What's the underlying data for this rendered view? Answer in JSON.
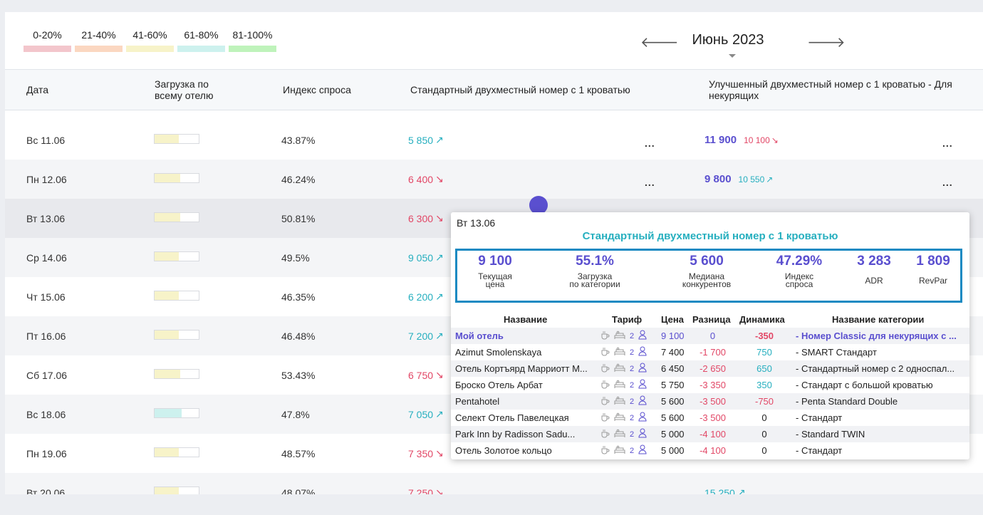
{
  "legend": [
    {
      "label": "0-20%",
      "color": "#f3c6cc"
    },
    {
      "label": "21-40%",
      "color": "#fbd7c1"
    },
    {
      "label": "41-60%",
      "color": "#f7f3c9"
    },
    {
      "label": "61-80%",
      "color": "#cdf1ee"
    },
    {
      "label": "81-100%",
      "color": "#bff3bb"
    }
  ],
  "nav": {
    "month": "Июнь 2023",
    "prev": "🡐",
    "next": "🡒"
  },
  "headers": {
    "date": "Дата",
    "load": "Загрузка по всему отелю",
    "demand": "Индекс спроса",
    "room1": "Стандартный двухместный номер с 1 кроватью",
    "room2": "Улучшенный двухместный номер с 1 кроватью - Для некурящих"
  },
  "rows": [
    {
      "date": "Вс 11.06",
      "load_pct": 55,
      "load_color": "#f7f3c9",
      "demand": "43.87%",
      "p1": "5 850",
      "p1_trend": "up",
      "p2": "11 900",
      "p2_sub": "10 100",
      "p2_trend": "down"
    },
    {
      "date": "Пн 12.06",
      "load_pct": 58,
      "load_color": "#f7f3c9",
      "demand": "46.24%",
      "p1": "6 400",
      "p1_trend": "down",
      "p2": "9 800",
      "p2_sub": "10 550",
      "p2_trend": "up"
    },
    {
      "date": "Вт 13.06",
      "load_pct": 58,
      "load_color": "#f7f3c9",
      "demand": "50.81%",
      "p1": "6 300",
      "p1_trend": "down",
      "p2": "",
      "p2_sub": "",
      "p2_trend": ""
    },
    {
      "date": "Ср 14.06",
      "load_pct": 55,
      "load_color": "#f7f3c9",
      "demand": "49.5%",
      "p1": "9 050",
      "p1_trend": "up",
      "p2": "",
      "p2_sub": "",
      "p2_trend": ""
    },
    {
      "date": "Чт 15.06",
      "load_pct": 55,
      "load_color": "#f7f3c9",
      "demand": "46.35%",
      "p1": "6 200",
      "p1_trend": "up",
      "p2": "",
      "p2_sub": "",
      "p2_trend": ""
    },
    {
      "date": "Пт 16.06",
      "load_pct": 55,
      "load_color": "#f7f3c9",
      "demand": "46.48%",
      "p1": "7 200",
      "p1_trend": "up",
      "p2": "",
      "p2_sub": "",
      "p2_trend": ""
    },
    {
      "date": "Сб 17.06",
      "load_pct": 58,
      "load_color": "#f7f3c9",
      "demand": "53.43%",
      "p1": "6 750",
      "p1_trend": "down",
      "p2": "",
      "p2_sub": "",
      "p2_trend": ""
    },
    {
      "date": "Вс 18.06",
      "load_pct": 62,
      "load_color": "#cdf1ee",
      "demand": "47.8%",
      "p1": "7 050",
      "p1_trend": "up",
      "p2": "",
      "p2_sub": "",
      "p2_trend": ""
    },
    {
      "date": "Пн 19.06",
      "load_pct": 55,
      "load_color": "#f7f3c9",
      "demand": "48.57%",
      "p1": "7 350",
      "p1_trend": "down",
      "p2": "",
      "p2_sub": "",
      "p2_trend": ""
    },
    {
      "date": "Вт 20.06",
      "load_pct": 55,
      "load_color": "#f7f3c9",
      "demand": "48.07%",
      "p1": "7 250",
      "p1_trend": "down",
      "p2": "15 250",
      "p2_sub": "",
      "p2_trend": "up"
    }
  ],
  "trend_glyphs": {
    "up": "↗",
    "down": "↘"
  },
  "dots": "...",
  "popup": {
    "date": "Вт 13.06",
    "title": "Стандартный двухместный номер с 1 кроватью",
    "kpis": [
      {
        "value": "9 100",
        "label1": "Текущая",
        "label2": "цена"
      },
      {
        "value": "55.1%",
        "label1": "Загрузка",
        "label2": "по категории"
      },
      {
        "value": "5 600",
        "label1": "Медиана",
        "label2": "конкурентов"
      },
      {
        "value": "47.29%",
        "label1": "Индекс",
        "label2": "спроса"
      },
      {
        "value": "3 283",
        "label1": "ADR",
        "label2": ""
      },
      {
        "value": "1 809",
        "label1": "RevPar",
        "label2": ""
      }
    ],
    "columns": {
      "name": "Название",
      "tariff": "Тариф",
      "price": "Цена",
      "diff": "Разница",
      "dynamics": "Динамика",
      "category": "Название категории"
    },
    "rows": [
      {
        "name": "Мой отель",
        "guests": "2",
        "price": "9 100",
        "diff": "0",
        "dyn": "-350",
        "category": "- Номер Classic для некурящих с ...",
        "own": true
      },
      {
        "name": "Azimut Smolenskaya",
        "guests": "2",
        "price": "7 400",
        "diff": "-1 700",
        "dyn": "750",
        "category": "- SMART Стандарт",
        "own": false
      },
      {
        "name": "Отель Кортъярд Марриотт М...",
        "guests": "2",
        "price": "6 450",
        "diff": "-2 650",
        "dyn": "650",
        "category": "- Стандартный номер с 2 односпал...",
        "own": false
      },
      {
        "name": "Броско Отель Арбат",
        "guests": "2",
        "price": "5 750",
        "diff": "-3 350",
        "dyn": "350",
        "category": "- Стандарт с большой кроватью",
        "own": false
      },
      {
        "name": "Pentahotel",
        "guests": "2",
        "price": "5 600",
        "diff": "-3 500",
        "dyn": "-750",
        "category": "- Penta Standard Double",
        "own": false
      },
      {
        "name": "Селект Отель Павелецкая",
        "guests": "2",
        "price": "5 600",
        "diff": "-3 500",
        "dyn": "0",
        "category": "- Стандарт",
        "own": false
      },
      {
        "name": "Park Inn by Radisson Sadu...",
        "guests": "2",
        "price": "5 000",
        "diff": "-4 100",
        "dyn": "0",
        "category": "- Standard TWIN",
        "own": false
      },
      {
        "name": "Отель Золотое кольцо",
        "guests": "2",
        "price": "5 000",
        "diff": "-4 100",
        "dyn": "0",
        "category": "- Стандарт",
        "own": false
      }
    ]
  }
}
